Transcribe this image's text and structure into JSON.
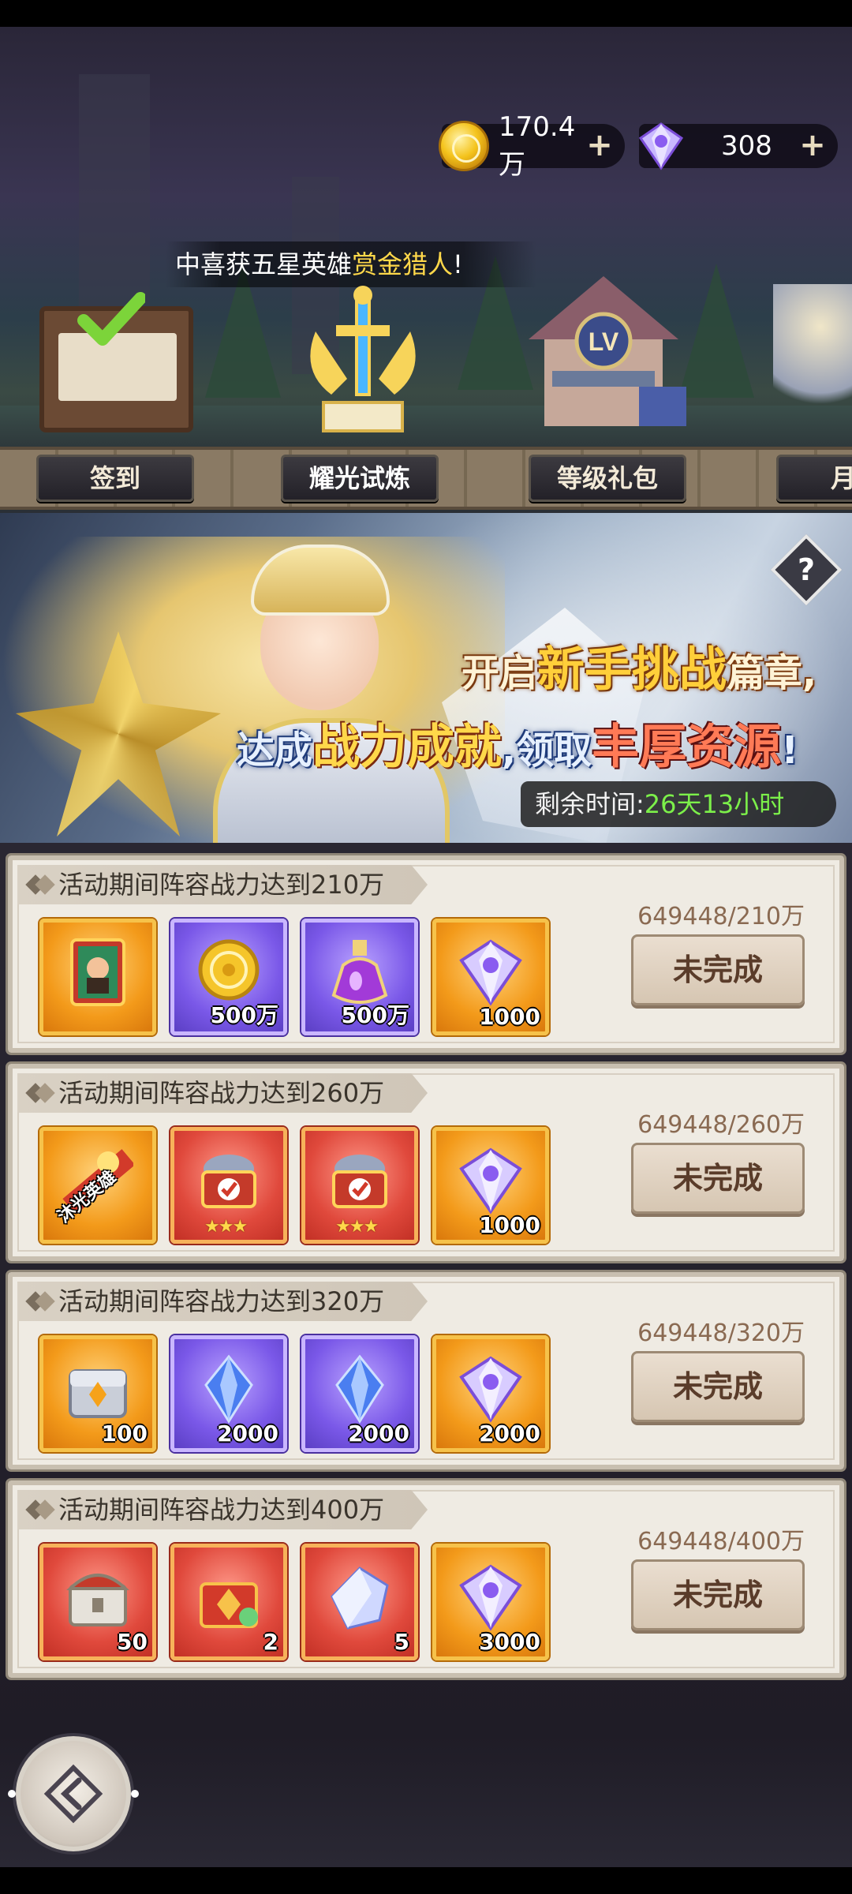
{
  "currency": {
    "gold": "170.4万",
    "diamond": "308"
  },
  "announcement": {
    "prefix": "中喜获五星英雄",
    "hero": "赏金猎人",
    "suffix": "!"
  },
  "nav_tabs": [
    {
      "label": "签到"
    },
    {
      "label": "耀光试炼"
    },
    {
      "label": "等级礼包"
    },
    {
      "label": "月"
    }
  ],
  "banner": {
    "line1_a": "开启",
    "line1_b": "新手挑战",
    "line1_c": "篇章,",
    "line2_a": "达成",
    "line2_b": "战力成就",
    "line2_c": ",领取",
    "line2_d": "丰厚资源",
    "line2_e": "!",
    "timer_label": "剩余时间:",
    "timer_value": "26天13小时"
  },
  "tasks": [
    {
      "title": "活动期间阵容战力达到210万",
      "progress": "649448/210万",
      "button": "未完成",
      "rewards": [
        {
          "icon": "hero-card-icon",
          "frame": "orange",
          "qty": ""
        },
        {
          "icon": "gold-coin-icon",
          "frame": "purple",
          "qty": "500万"
        },
        {
          "icon": "potion-icon",
          "frame": "purple",
          "qty": "500万"
        },
        {
          "icon": "diamond-icon",
          "frame": "orange",
          "qty": "1000"
        }
      ]
    },
    {
      "title": "活动期间阵容战力达到260万",
      "progress": "649448/260万",
      "button": "未完成",
      "rewards": [
        {
          "icon": "hero-ticket-icon",
          "frame": "orange",
          "qty": ""
        },
        {
          "icon": "equipment-chest-icon",
          "frame": "red",
          "qty": ""
        },
        {
          "icon": "equipment-chest-icon",
          "frame": "red",
          "qty": ""
        },
        {
          "icon": "diamond-icon",
          "frame": "orange",
          "qty": "1000"
        }
      ]
    },
    {
      "title": "活动期间阵容战力达到320万",
      "progress": "649448/320万",
      "button": "未完成",
      "rewards": [
        {
          "icon": "silver-chest-icon",
          "frame": "orange",
          "qty": "100"
        },
        {
          "icon": "crystal-icon",
          "frame": "purple",
          "qty": "2000"
        },
        {
          "icon": "crystal-icon",
          "frame": "purple",
          "qty": "2000"
        },
        {
          "icon": "diamond-icon",
          "frame": "orange",
          "qty": "2000"
        }
      ]
    },
    {
      "title": "活动期间阵容战力达到400万",
      "progress": "649448/400万",
      "button": "未完成",
      "rewards": [
        {
          "icon": "treasure-chest-icon",
          "frame": "red",
          "qty": "50"
        },
        {
          "icon": "red-chest-icon",
          "frame": "red",
          "qty": "2"
        },
        {
          "icon": "ice-cube-icon",
          "frame": "red",
          "qty": "5"
        },
        {
          "icon": "diamond-icon",
          "frame": "orange",
          "qty": "3000"
        }
      ]
    }
  ],
  "stars_text": "★★★",
  "hero_ticket_text": "沐光英雄",
  "help_label": "?"
}
